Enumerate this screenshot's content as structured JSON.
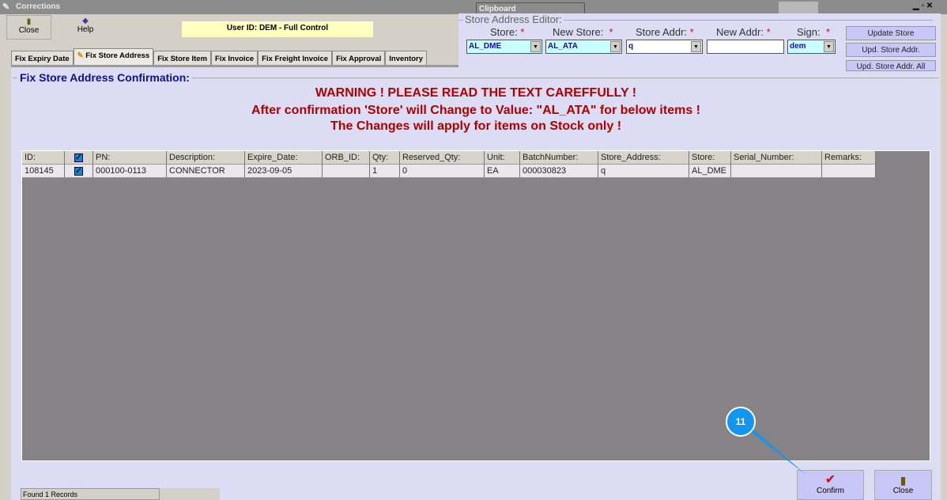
{
  "window": {
    "title": "Corrections",
    "clipboard": "Clipboard"
  },
  "toolbar": {
    "close": "Close",
    "help": "Help",
    "user": "User ID: DEM - Full Control"
  },
  "tabs": [
    "Fix Expiry Date",
    "Fix Store Address",
    "Fix Store Item",
    "Fix Invoice",
    "Fix Freight Invoice",
    "Fix Approval",
    "Inventory"
  ],
  "editor": {
    "title": "Store Address Editor:",
    "store_label": "Store:",
    "new_store_label": "New Store:",
    "store_addr_label": "Store Addr:",
    "new_addr_label": "New Addr:",
    "sign_label": "Sign:",
    "req": "*",
    "store": "AL_DME",
    "new_store": "AL_ATA",
    "store_addr": "q",
    "new_addr": "",
    "sign": "dem",
    "update_store": "Update Store",
    "upd_store_addr": "Upd. Store Addr.",
    "upd_store_addr_all": "Upd. Store Addr. All"
  },
  "confirmation": {
    "title": "Fix Store Address Confirmation:",
    "warn1": "WARNING ! PLEASE READ THE TEXT CAREFFULLY !",
    "warn2": "After confirmation 'Store' will Change to Value: \"AL_ATA\" for below items !",
    "warn3": "The Changes will apply for items on Stock only !"
  },
  "table": {
    "columns": [
      "ID:",
      "",
      "PN:",
      "Description:",
      "Expire_Date:",
      "ORB_ID:",
      "Qty:",
      "Reserved_Qty:",
      "Unit:",
      "BatchNumber:",
      "Store_Address:",
      "Store:",
      "Serial_Number:",
      "Remarks:"
    ],
    "rows": [
      [
        "108145",
        "",
        "000100-0113",
        "CONNECTOR",
        "2023-09-05",
        "",
        "1",
        "0",
        "EA",
        "000030823",
        "q",
        "AL_DME",
        "",
        ""
      ]
    ]
  },
  "status": "Found 1 Records",
  "buttons": {
    "confirm": "Confirm",
    "close": "Close"
  },
  "callout": "11"
}
